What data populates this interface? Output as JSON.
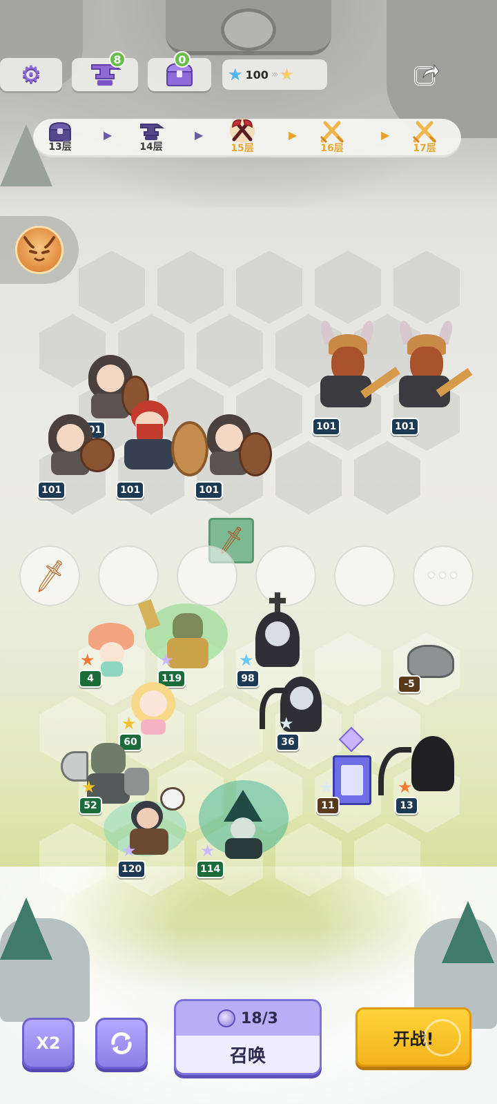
{
  "hud": {
    "anvil_count": "8",
    "chest_count": "0",
    "stars": "100",
    "icons": [
      "gear-icon",
      "anvil-icon",
      "treasure-chest-icon",
      "blue-star-icon",
      "rainbow-star-icon",
      "share-icon"
    ]
  },
  "progress": {
    "stages": [
      {
        "label": "13层",
        "icon": "treasure-chest-icon",
        "state": "done"
      },
      {
        "label": "14层",
        "icon": "anvil-icon",
        "state": "done"
      },
      {
        "label": "15层",
        "icon": "crossed-axes-icon",
        "state": "current"
      },
      {
        "label": "16层",
        "icon": "crossed-swords-icon",
        "state": "upcoming"
      },
      {
        "label": "17层",
        "icon": "crossed-swords-icon",
        "state": "upcoming"
      }
    ]
  },
  "enemies": [
    {
      "name": "hooded-dwarf",
      "level": "101"
    },
    {
      "name": "hooded-dwarf",
      "level": "101"
    },
    {
      "name": "red-beard-dwarf",
      "level": "101"
    },
    {
      "name": "hooded-dwarf",
      "level": "101"
    },
    {
      "name": "viking-dwarf",
      "level": "101"
    },
    {
      "name": "viking-dwarf",
      "level": "101"
    }
  ],
  "equipment_slots": {
    "more_label": "•••"
  },
  "allies": [
    {
      "name": "mushroom-girl",
      "level": "4",
      "star": "orange"
    },
    {
      "name": "green-knight",
      "level": "119",
      "star": "lavender"
    },
    {
      "name": "nun",
      "level": "98",
      "star": "blue"
    },
    {
      "name": "rock",
      "level": "-5",
      "star": "none"
    },
    {
      "name": "blonde-girl",
      "level": "60",
      "star": "gold"
    },
    {
      "name": "reaper-nun",
      "level": "36",
      "star": "silver"
    },
    {
      "name": "axe-warrior",
      "level": "52",
      "star": "gold"
    },
    {
      "name": "crystal-tower",
      "level": "11",
      "star": "silver"
    },
    {
      "name": "reaper",
      "level": "13",
      "star": "orange"
    },
    {
      "name": "eagle-hunter",
      "level": "120",
      "star": "lavender"
    },
    {
      "name": "swamp-witch",
      "level": "114",
      "star": "lavender"
    }
  ],
  "controls": {
    "speed_label": "X2",
    "summon_cost": "18/3",
    "summon_label": "召唤",
    "fight_label": "开战!"
  }
}
